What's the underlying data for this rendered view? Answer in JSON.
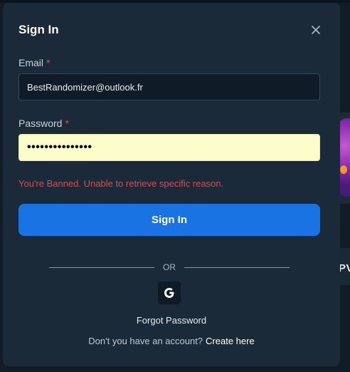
{
  "modal": {
    "title": "Sign In",
    "close_icon": "close-icon"
  },
  "email": {
    "label": "Email",
    "required_marker": "*",
    "value": "BestRandomizer@outlook.fr"
  },
  "password": {
    "label": "Password",
    "required_marker": "*",
    "masked_value": "•••••••••••••••",
    "autofill_color": "#fdfdcc"
  },
  "error": {
    "message": "You're Banned. Unable to retrieve specific reason.",
    "color": "#ee4444"
  },
  "submit": {
    "label": "Sign In",
    "color": "#1a73e3"
  },
  "divider": {
    "label": "OR"
  },
  "social": {
    "google_icon": "google-icon"
  },
  "links": {
    "forgot_password": "Forgot Password",
    "no_account_prompt": "Don't you have an account?",
    "create_account": "Create here"
  },
  "background": {
    "partial_text": "PV"
  }
}
